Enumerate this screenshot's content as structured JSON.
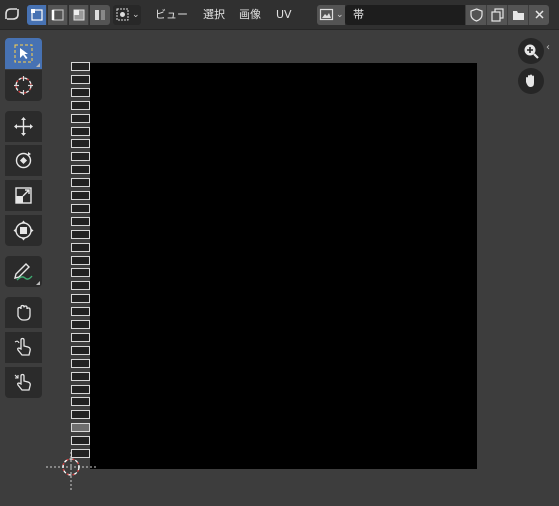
{
  "header": {
    "menus": [
      "ビュー",
      "選択",
      "画像",
      "UV"
    ],
    "image_name": "帯"
  },
  "toolbar": {
    "tools": [
      {
        "name": "select-box",
        "active": true
      },
      {
        "name": "cursor"
      },
      {
        "name": "move"
      },
      {
        "name": "rotate"
      },
      {
        "name": "scale"
      },
      {
        "name": "transform"
      },
      {
        "name": "annotate"
      },
      {
        "name": "grab"
      },
      {
        "name": "relax"
      },
      {
        "name": "pinch"
      }
    ]
  },
  "uv_strip": {
    "count": 31,
    "selected_index": 28
  },
  "colors": {
    "accent": "#4772b3",
    "header_bg": "#303030",
    "editor_bg": "#3d3d3d",
    "canvas": "#000000"
  }
}
